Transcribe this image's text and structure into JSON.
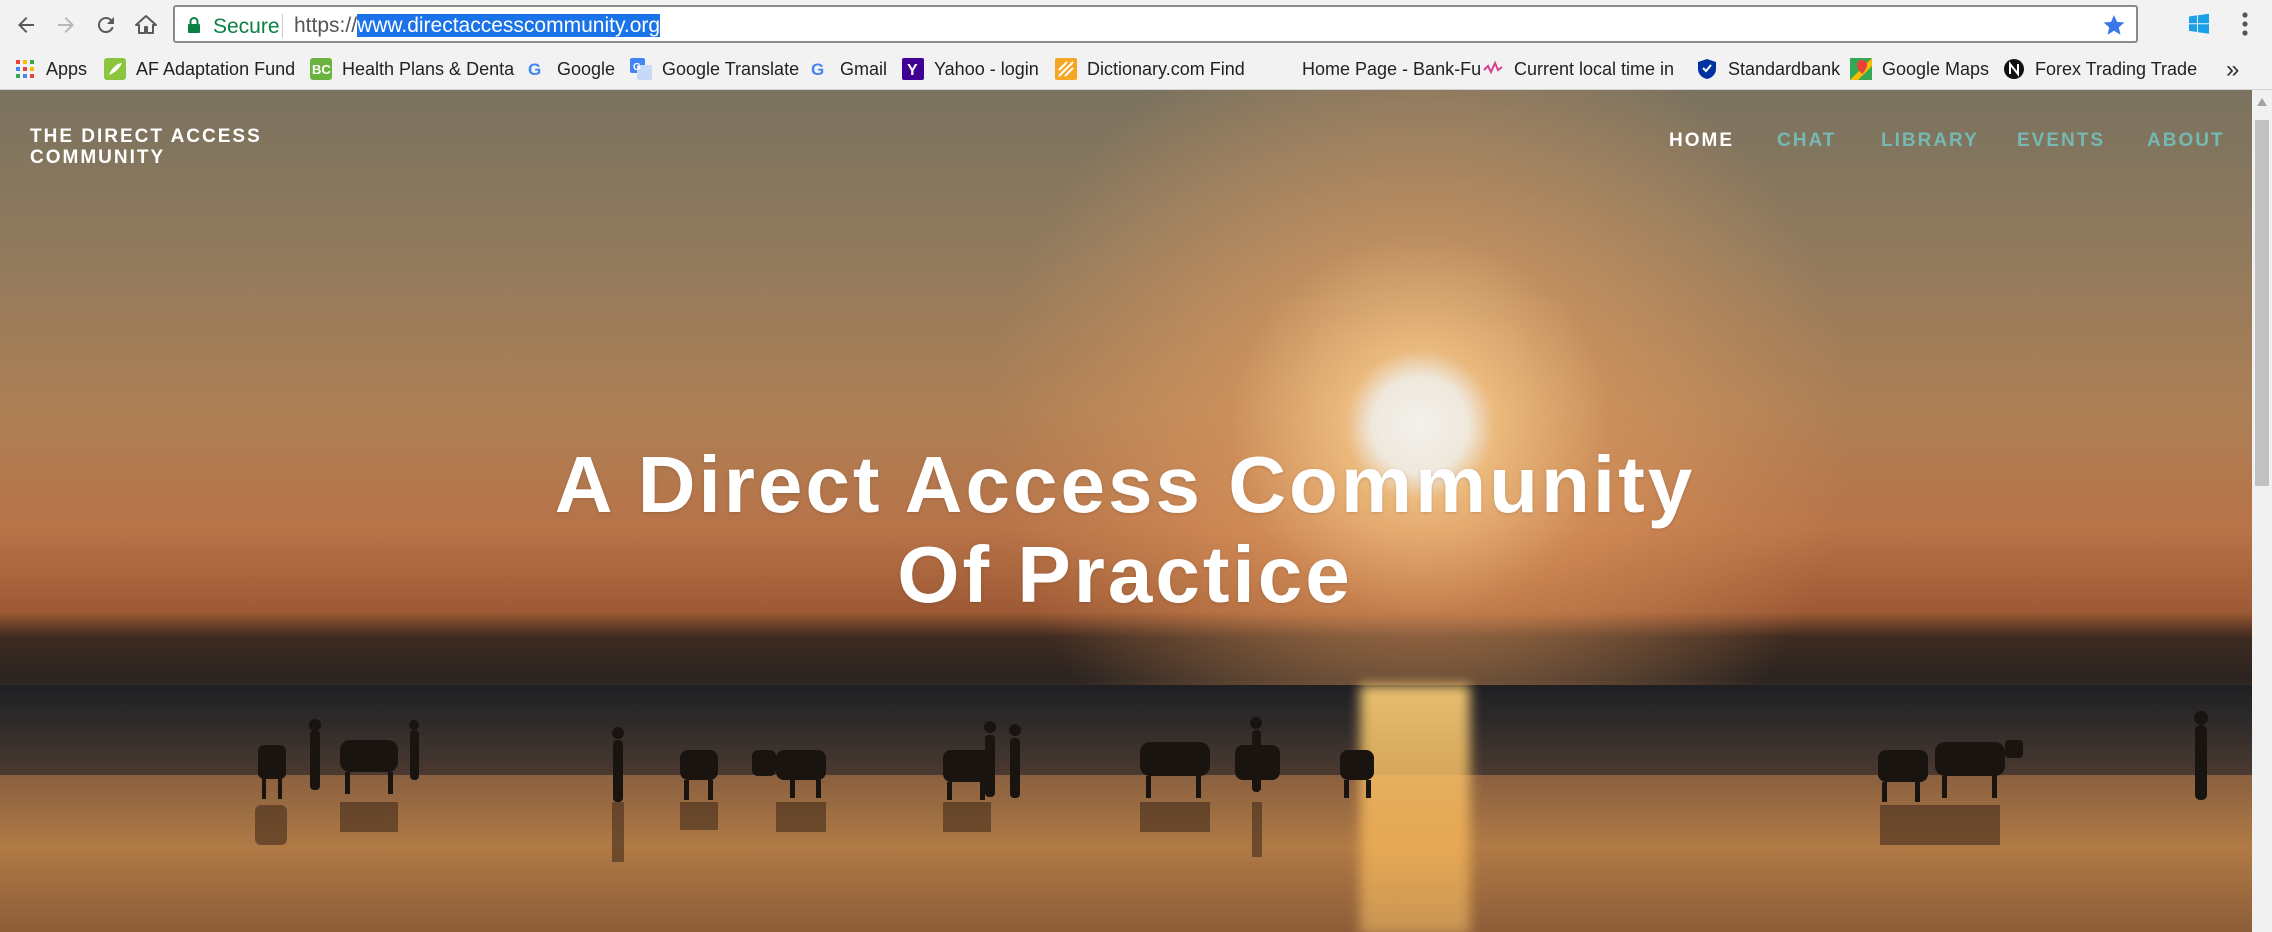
{
  "browser": {
    "secure_label": "Secure",
    "url_scheme": "https://",
    "url_host": "www.directaccesscommunity.org"
  },
  "bookmarks": [
    {
      "label": "Apps",
      "icon": "apps-grid-icon"
    },
    {
      "label": "AF  Adaptation Fund",
      "icon": "adaptation-fund-icon"
    },
    {
      "label": "Health Plans & Denta",
      "icon": "health-plans-icon"
    },
    {
      "label": "Google",
      "icon": "google-icon"
    },
    {
      "label": "Google Translate",
      "icon": "google-translate-icon"
    },
    {
      "label": "Gmail",
      "icon": "google-icon"
    },
    {
      "label": "Yahoo - login",
      "icon": "yahoo-icon"
    },
    {
      "label": "Dictionary.com  Find",
      "icon": "dictionary-icon"
    },
    {
      "label": "Home Page - Bank-Fu",
      "icon": ""
    },
    {
      "label": "Current local time in",
      "icon": "timeanddate-icon"
    },
    {
      "label": "Standardbank",
      "icon": "standardbank-shield-icon"
    },
    {
      "label": "Google Maps",
      "icon": "google-maps-icon"
    },
    {
      "label": "Forex Trading  Trade",
      "icon": "forex-icon"
    }
  ],
  "site": {
    "logo_text": "THE DIRECT ACCESS COMMUNITY",
    "nav": [
      {
        "label": "HOME",
        "active": true
      },
      {
        "label": "CHAT",
        "active": false
      },
      {
        "label": "LIBRARY",
        "active": false
      },
      {
        "label": "EVENTS",
        "active": false
      },
      {
        "label": "ABOUT",
        "active": false
      }
    ],
    "hero_title_line1": "A Direct Access Community",
    "hero_title_line2": "Of Practice"
  },
  "colors": {
    "nav_link": "#74b9b2",
    "nav_active": "#ffffff",
    "url_highlight": "#1a73e8",
    "secure_green": "#0b8043"
  }
}
